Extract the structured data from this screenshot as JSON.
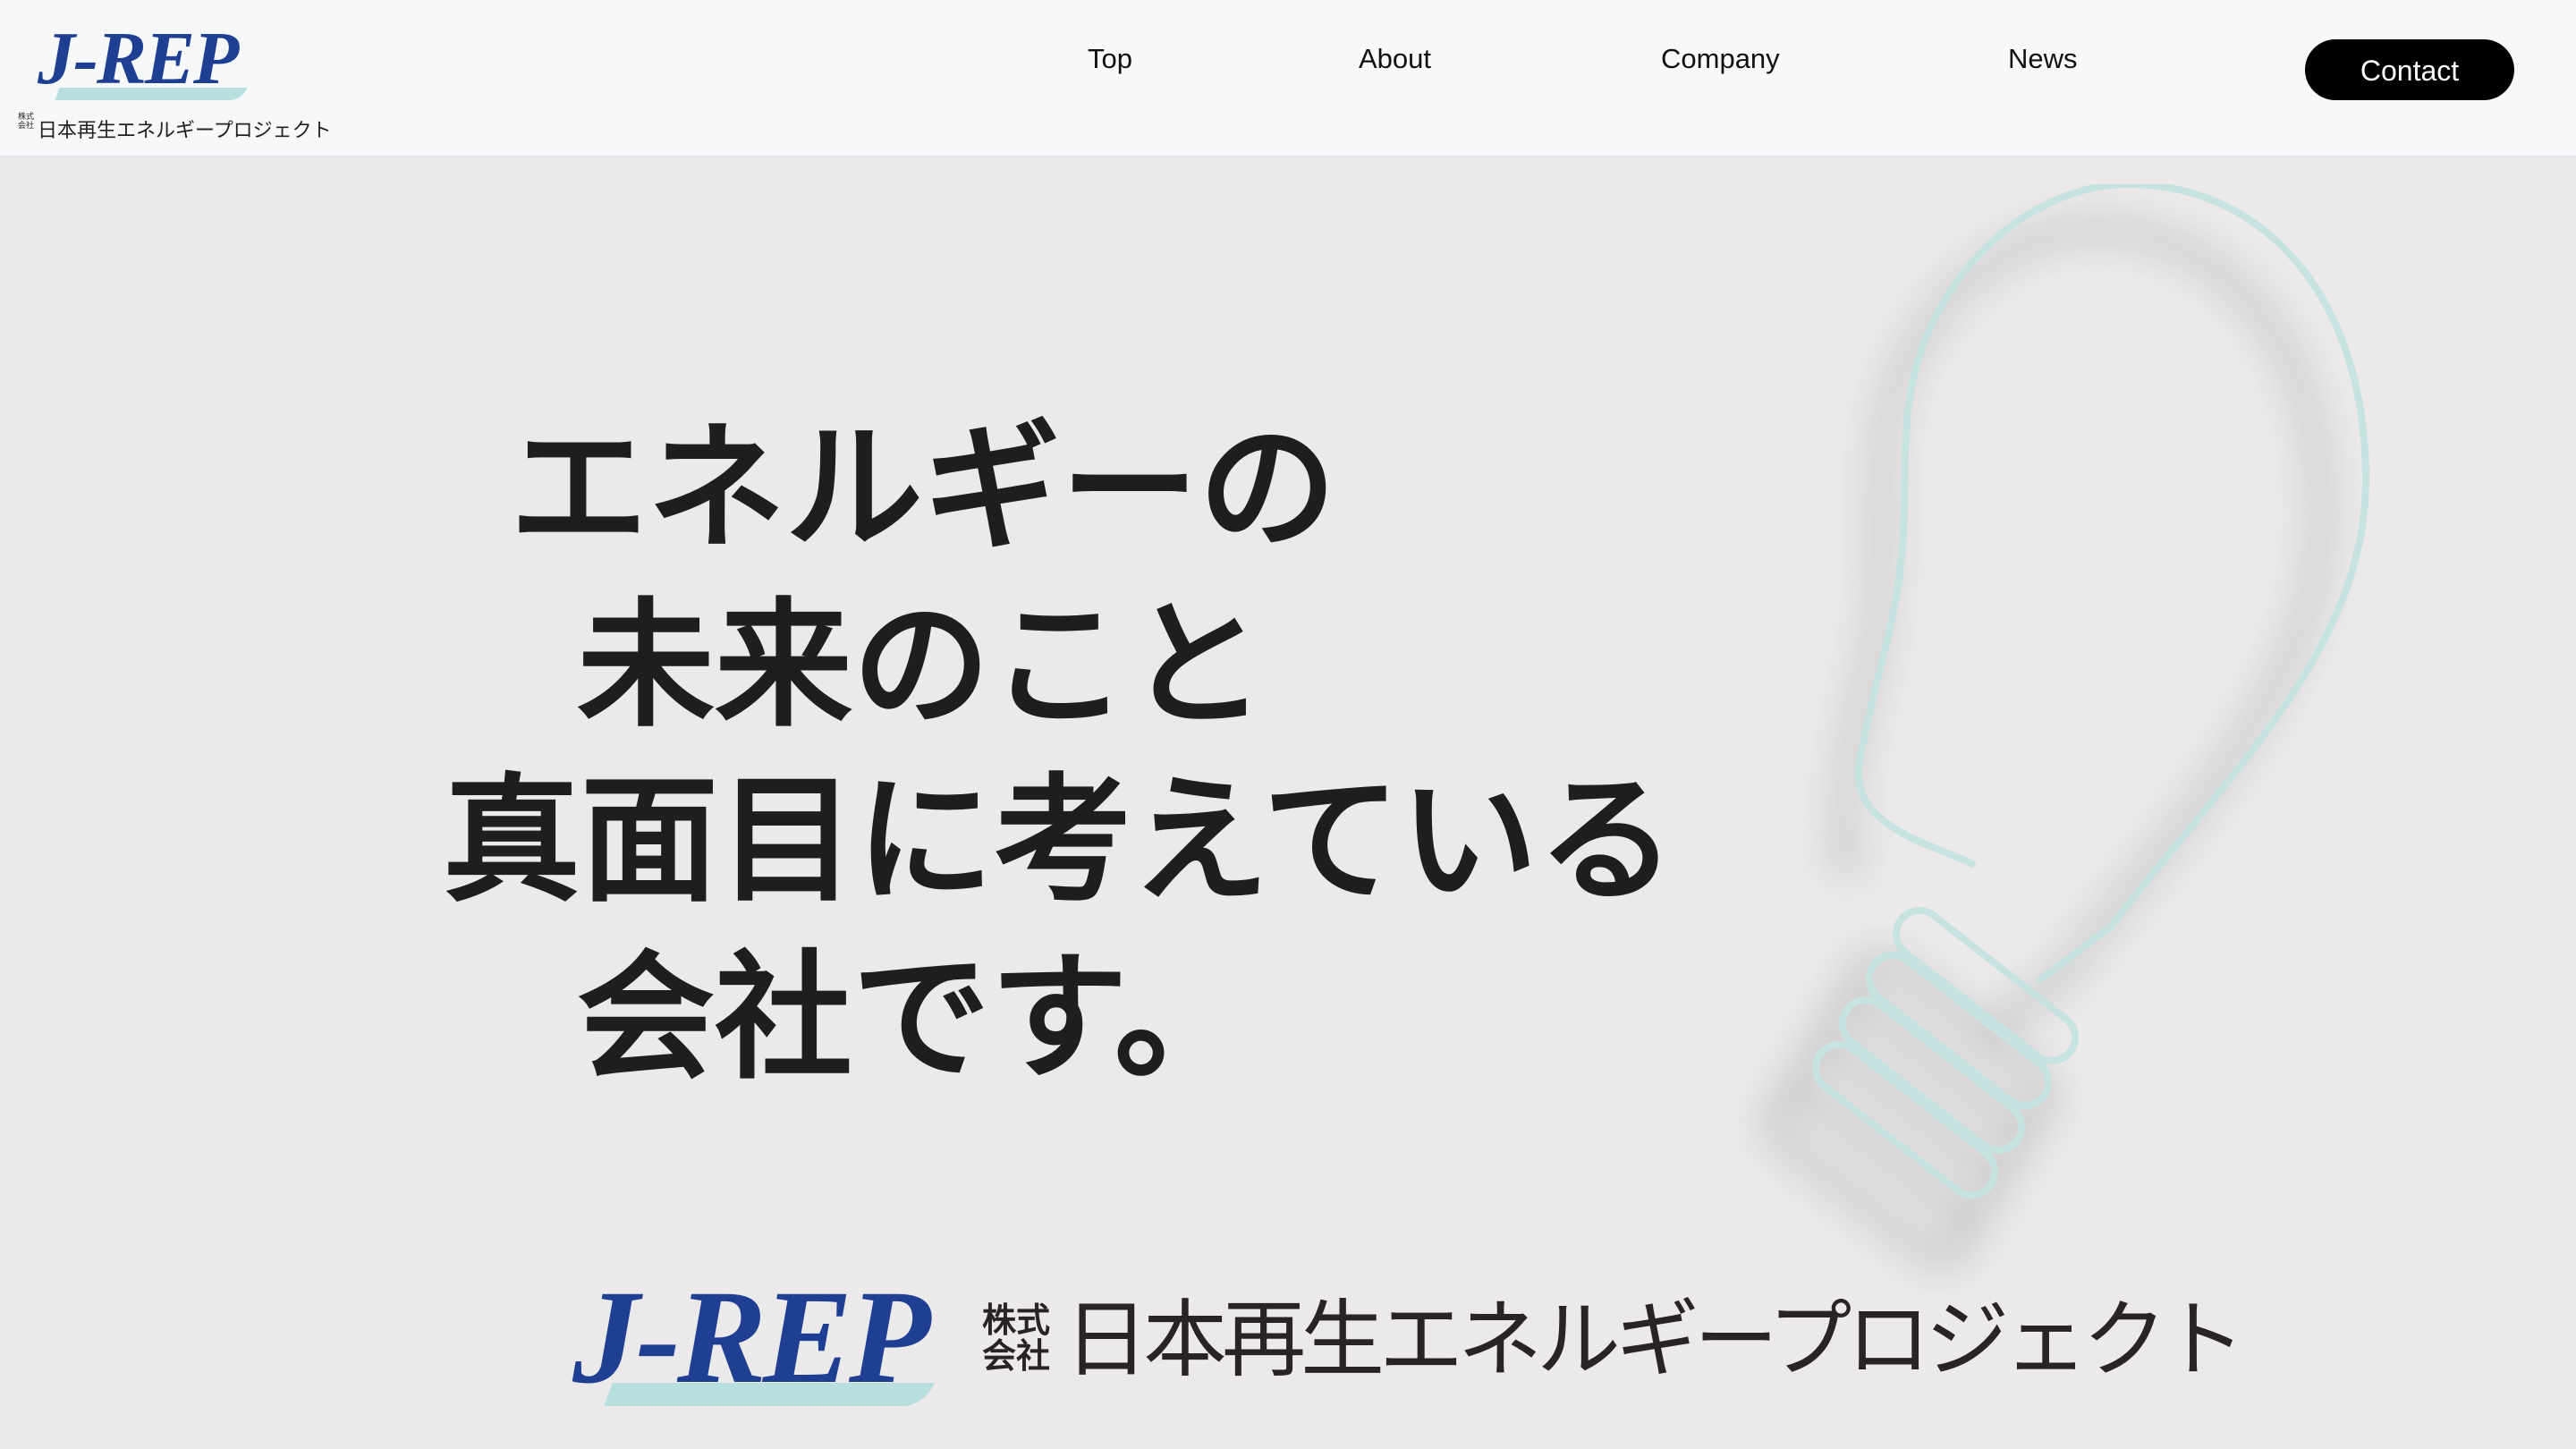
{
  "header": {
    "logo": {
      "mark": "J-REP",
      "kabushiki": "株式会社",
      "company_name": "日本再生エネルギープロジェクト"
    },
    "nav": [
      {
        "label": "Top"
      },
      {
        "label": "About"
      },
      {
        "label": "Company"
      },
      {
        "label": "News"
      }
    ],
    "contact_label": "Contact"
  },
  "hero": {
    "headline": [
      "エネルギーの",
      "未来のこと",
      "真面目に考えている",
      "会社です。"
    ]
  },
  "footer_logo": {
    "mark": "J-REP",
    "kabushiki": "株式会社",
    "company_name": "日本再生エネルギープロジェクト"
  },
  "colors": {
    "brand_blue": "#1f3f93",
    "swoosh_teal": "#b7dfdd",
    "background": "#ebe9ea",
    "header_bg": "#f7f8fa",
    "contact_bg": "#000000"
  },
  "icons": [
    "light-bulb-icon"
  ]
}
